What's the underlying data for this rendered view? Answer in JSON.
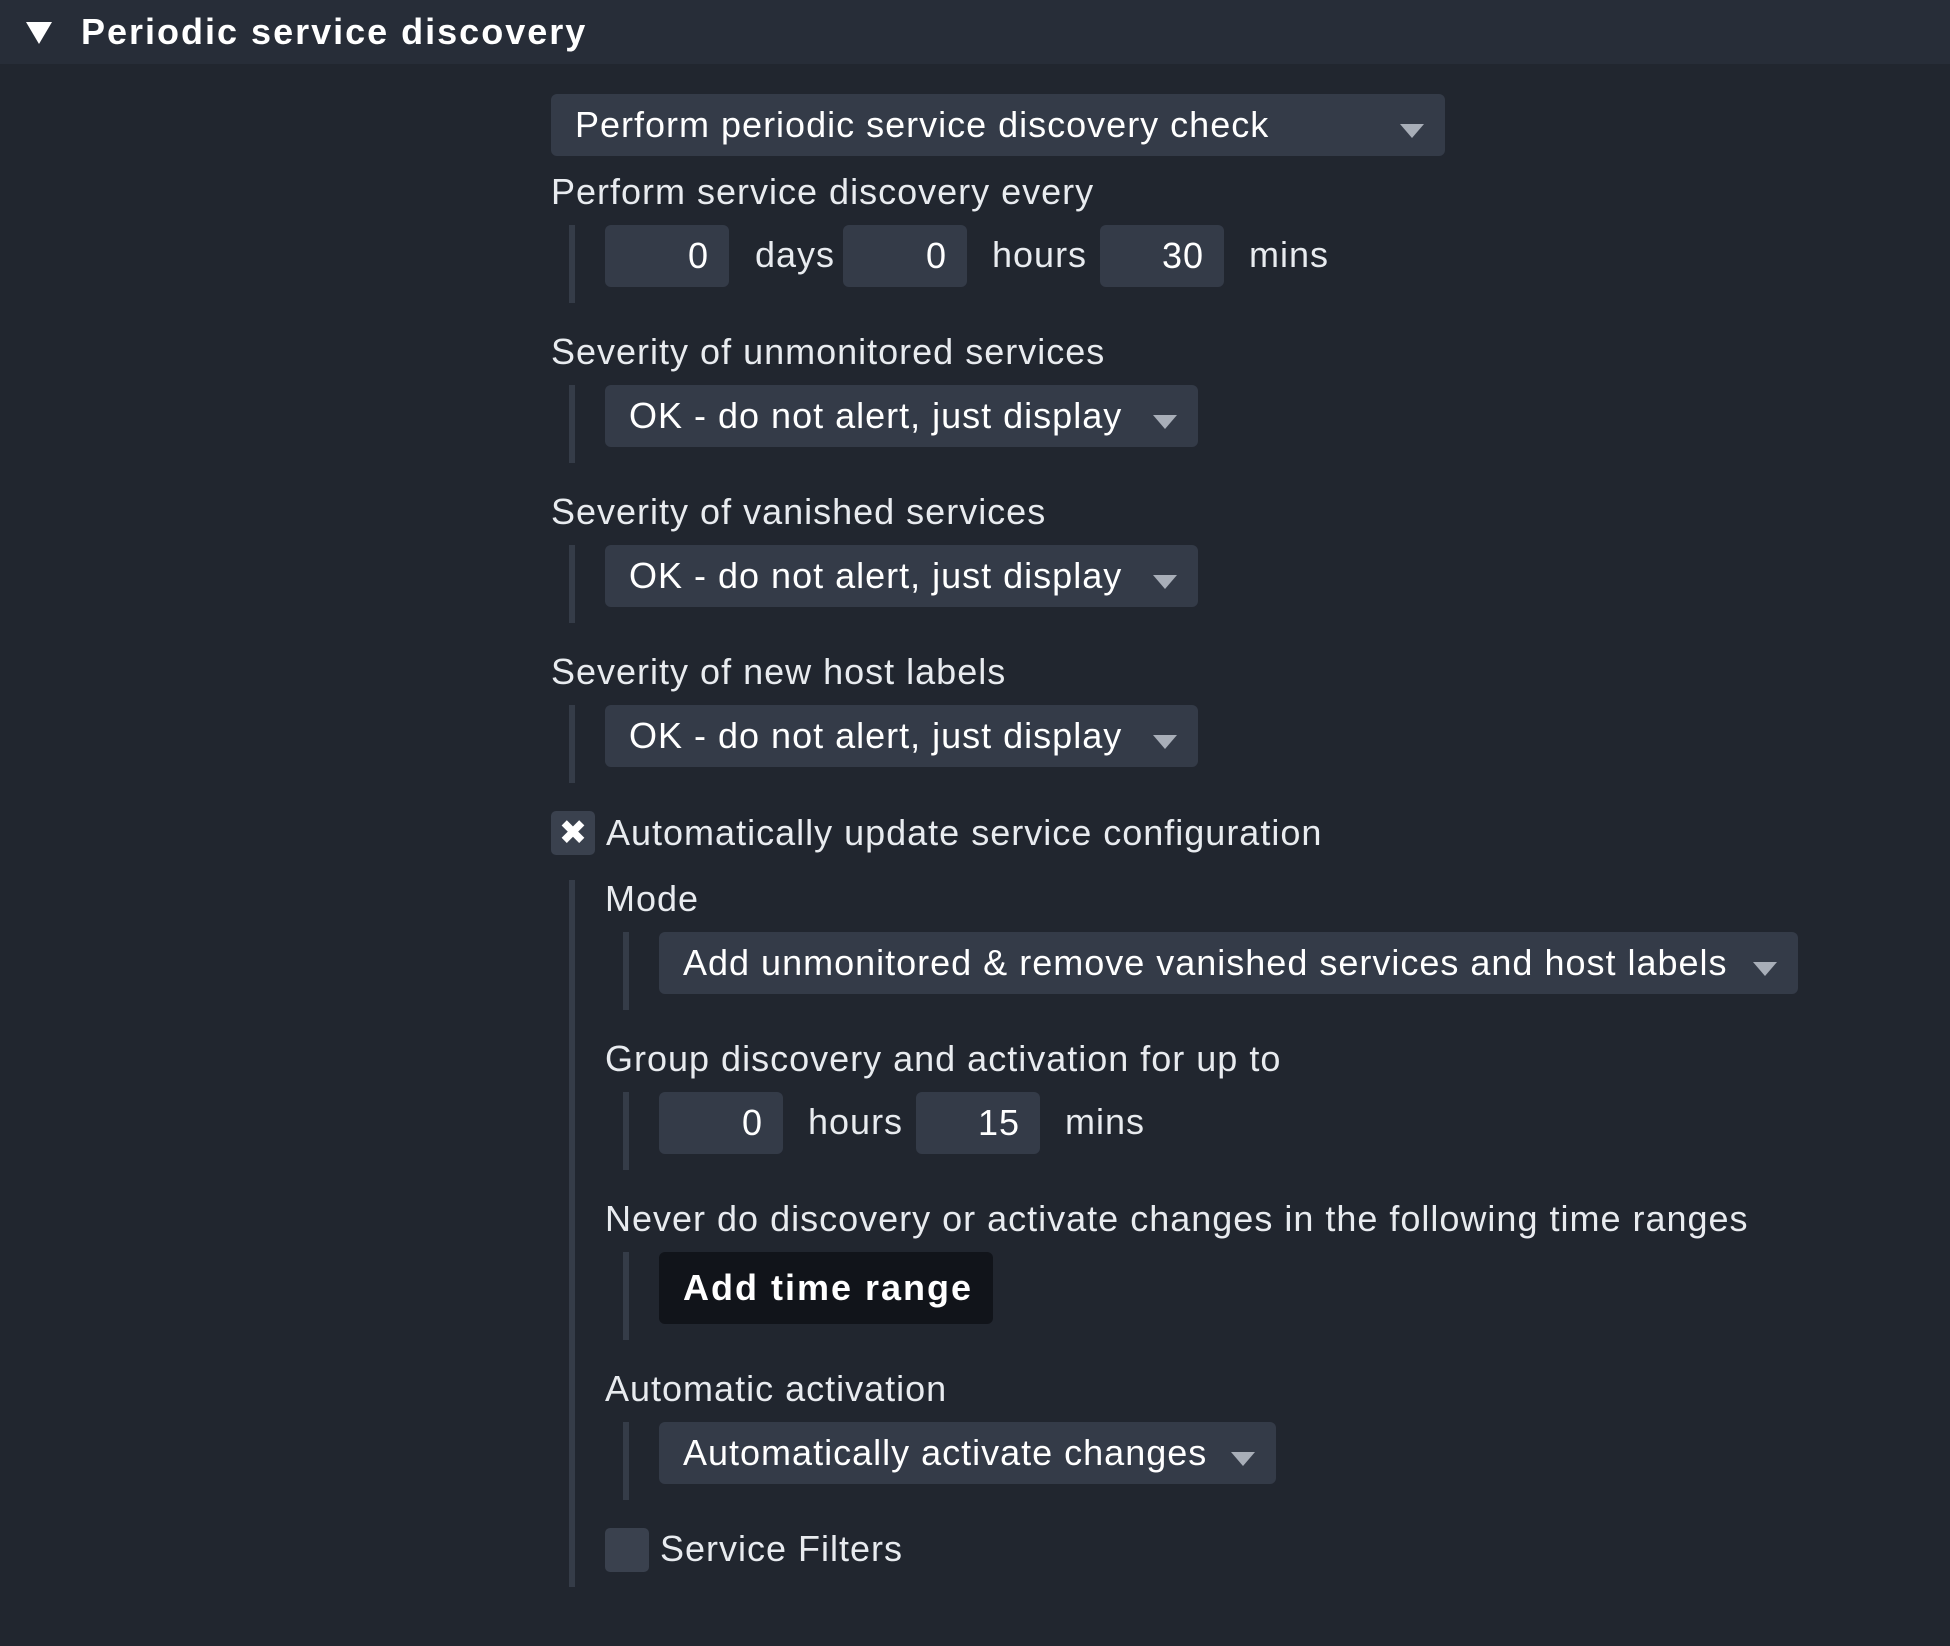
{
  "header": {
    "title": "Periodic service discovery"
  },
  "main_select": {
    "value": "Perform periodic service discovery check"
  },
  "interval": {
    "label": "Perform service discovery every",
    "days": "0",
    "days_unit": "days",
    "hours": "0",
    "hours_unit": "hours",
    "mins": "30",
    "mins_unit": "mins"
  },
  "severity_unmonitored": {
    "label": "Severity of unmonitored services",
    "value": "OK - do not alert, just display"
  },
  "severity_vanished": {
    "label": "Severity of vanished services",
    "value": "OK - do not alert, just display"
  },
  "severity_labels": {
    "label": "Severity of new host labels",
    "value": "OK - do not alert, just display"
  },
  "auto_update": {
    "label": "Automatically update service configuration",
    "checked": true,
    "check_glyph": "✖",
    "mode": {
      "label": "Mode",
      "value": "Add unmonitored & remove vanished services and host labels"
    },
    "group": {
      "label": "Group discovery and activation for up to",
      "hours": "0",
      "hours_unit": "hours",
      "mins": "15",
      "mins_unit": "mins"
    },
    "never": {
      "label": "Never do discovery or activate changes in the following time ranges",
      "button": "Add time range"
    },
    "activation": {
      "label": "Automatic activation",
      "value": "Automatically activate changes"
    },
    "filters": {
      "label": "Service Filters",
      "checked": false
    }
  },
  "icons": {
    "header_toggle": "triangle-down-icon",
    "checkbox_checked": "x-mark-icon",
    "dropdown": "caret-down-icon"
  }
}
